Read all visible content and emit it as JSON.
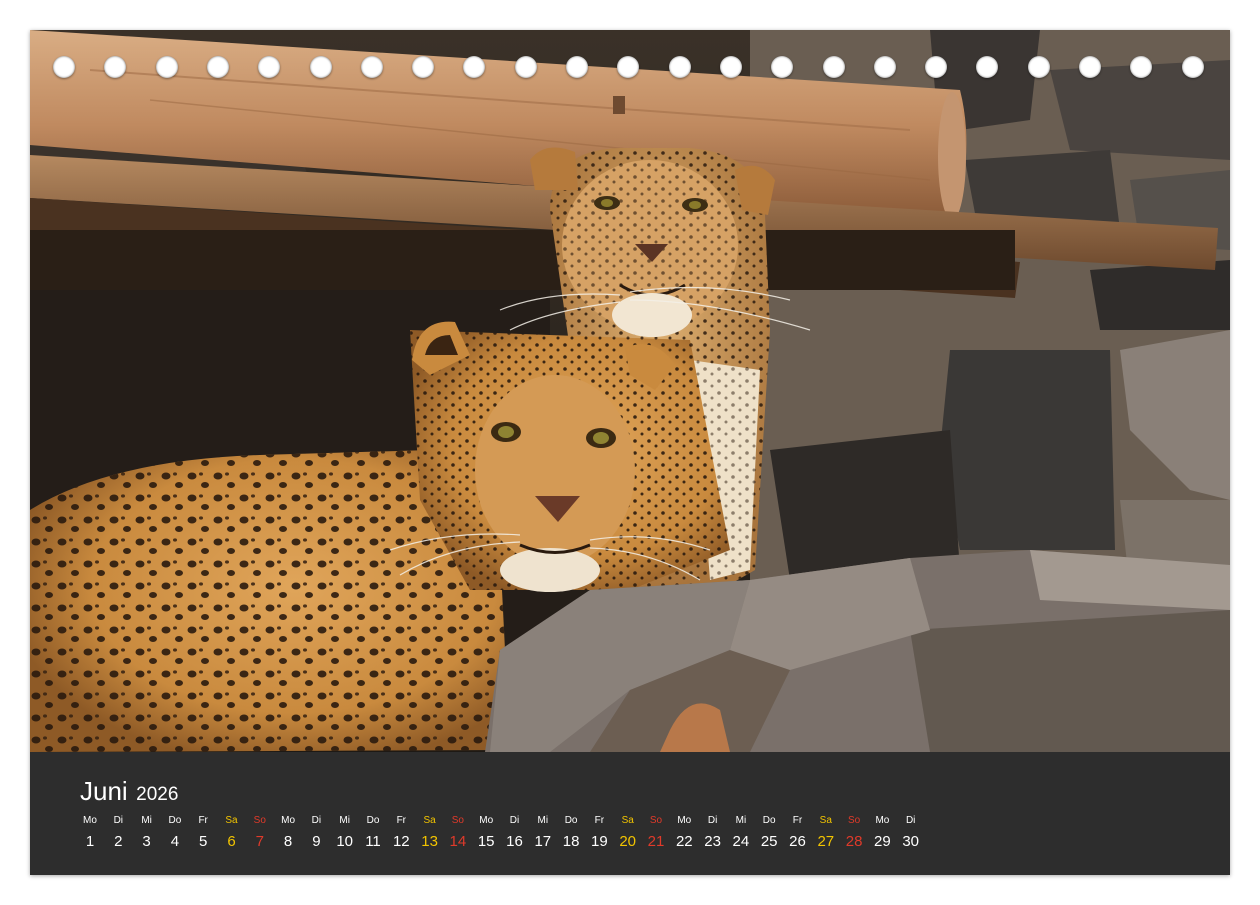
{
  "calendar": {
    "month": "Juni",
    "year": "2026",
    "colors": {
      "weekday": "#ffffff",
      "saturday": "#f2c400",
      "sunday": "#e03a2a"
    },
    "days": [
      {
        "dow": "Mo",
        "num": "1",
        "type": "weekday"
      },
      {
        "dow": "Di",
        "num": "2",
        "type": "weekday"
      },
      {
        "dow": "Mi",
        "num": "3",
        "type": "weekday"
      },
      {
        "dow": "Do",
        "num": "4",
        "type": "weekday"
      },
      {
        "dow": "Fr",
        "num": "5",
        "type": "weekday"
      },
      {
        "dow": "Sa",
        "num": "6",
        "type": "saturday"
      },
      {
        "dow": "So",
        "num": "7",
        "type": "sunday"
      },
      {
        "dow": "Mo",
        "num": "8",
        "type": "weekday"
      },
      {
        "dow": "Di",
        "num": "9",
        "type": "weekday"
      },
      {
        "dow": "Mi",
        "num": "10",
        "type": "weekday"
      },
      {
        "dow": "Do",
        "num": "11",
        "type": "weekday"
      },
      {
        "dow": "Fr",
        "num": "12",
        "type": "weekday"
      },
      {
        "dow": "Sa",
        "num": "13",
        "type": "saturday"
      },
      {
        "dow": "So",
        "num": "14",
        "type": "sunday"
      },
      {
        "dow": "Mo",
        "num": "15",
        "type": "weekday"
      },
      {
        "dow": "Di",
        "num": "16",
        "type": "weekday"
      },
      {
        "dow": "Mi",
        "num": "17",
        "type": "weekday"
      },
      {
        "dow": "Do",
        "num": "18",
        "type": "weekday"
      },
      {
        "dow": "Fr",
        "num": "19",
        "type": "weekday"
      },
      {
        "dow": "Sa",
        "num": "20",
        "type": "saturday"
      },
      {
        "dow": "So",
        "num": "21",
        "type": "sunday"
      },
      {
        "dow": "Mo",
        "num": "22",
        "type": "weekday"
      },
      {
        "dow": "Di",
        "num": "23",
        "type": "weekday"
      },
      {
        "dow": "Mi",
        "num": "24",
        "type": "weekday"
      },
      {
        "dow": "Do",
        "num": "25",
        "type": "weekday"
      },
      {
        "dow": "Fr",
        "num": "26",
        "type": "weekday"
      },
      {
        "dow": "Sa",
        "num": "27",
        "type": "saturday"
      },
      {
        "dow": "So",
        "num": "28",
        "type": "sunday"
      },
      {
        "dow": "Mo",
        "num": "29",
        "type": "weekday"
      },
      {
        "dow": "Di",
        "num": "30",
        "type": "weekday"
      }
    ]
  },
  "photo": {
    "subject": "leopard-photo"
  }
}
